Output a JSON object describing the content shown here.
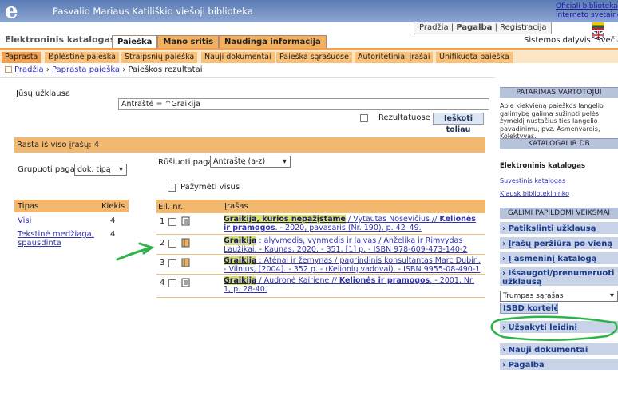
{
  "header": {
    "logo": "e",
    "title": "Pasvalio Mariaus Katiliškio viešoji biblioteka",
    "links": [
      "Oficiali biblioteka",
      "interneto svetainė"
    ]
  },
  "util": {
    "home": "Pradžia",
    "help": "Pagalba",
    "register": "Registracija",
    "member": "Sistemos dalyvis: Svečias"
  },
  "app": {
    "name": "Elektroninis katalogas"
  },
  "tabs": [
    "Paieška",
    "Mano sritis",
    "Naudinga informacija"
  ],
  "subtabs": [
    "Paprasta",
    "Išplėstinė paieška",
    "Straipsnių paieška",
    "Nauji dokumentai",
    "Paieška sąrašuose",
    "Autoritetiniai įrašai",
    "Unifikuota paieška"
  ],
  "breadcrumb": {
    "home": "Pradžia",
    "simple": "Paprasta paieška",
    "current": "Paieškos rezultatai"
  },
  "query": {
    "label": "Jūsų užklausa",
    "value": "Antraštė = ^Graikija",
    "in_results": "Rezultatuose",
    "search_button": "Ieškoti toliau"
  },
  "found": {
    "label": "Rasta iš viso įrašų: 4"
  },
  "group": {
    "label": "Grupuoti pagal",
    "value": "dok. tipą"
  },
  "sort": {
    "label": "Rūšiuoti pagal",
    "value": "Antraštę (a-z)",
    "select_all": "Pažymėti visus"
  },
  "types": {
    "col_type": "Tipas",
    "col_count": "Kiekis",
    "rows": [
      {
        "name": "Visi",
        "count": "4"
      },
      {
        "name": "Tekstinė medžiaga, spausdinta",
        "count": "4"
      }
    ]
  },
  "results": {
    "col_no": "Eil. nr.",
    "col_record": "Įrašas",
    "rows": [
      {
        "no": "1",
        "icon": "article",
        "title": "Graikija, kurios nepažįstame",
        "rest": " / Vytautas Nosevičius // ",
        "src": "Kelionės ir pramogos",
        "tail": ". - 2020, pavasaris (Nr. 190), p. 42–49."
      },
      {
        "no": "2",
        "icon": "book",
        "title": "Graikija",
        "rest": " : alyvmedis, vynmedis ir laivas / Anželika ir Rimvydas Laužikai. - Kaunas, 2020. - 351, [1] p. - ISBN 978-609-473-140-2",
        "src": "",
        "tail": ""
      },
      {
        "no": "3",
        "icon": "book",
        "title": "Graikija",
        "rest": " : Atėnai ir žemynas / pagrindinis konsultantas Marc Dubin. - Vilnius, [2004]. - 352 p. - (Kelionių vadovai). - ISBN 9955-08-490-1",
        "src": "",
        "tail": ""
      },
      {
        "no": "4",
        "icon": "article",
        "title": "Graikija",
        "rest": " / Audronė Kairienė // ",
        "src": "Kelionės ir pramogos",
        "tail": ". - 2001, Nr. 1, p. 28-40."
      }
    ]
  },
  "right": {
    "tip_header": "PATARIMAS VARTOTOJUI",
    "tip_text": "Apie kiekvieną paieškos langelio galimybę galima sužinoti pelės žymeklį nustačius ties langelio pavadinimu, pvz. Asmenvardis, Kolektyvas.",
    "cat_header": "KATALOGAI IR DB",
    "cat_title": "Elektroninis katalogas",
    "cat_links": [
      "Suvestinis katalogas",
      "Klausk bibliotekininko"
    ],
    "act_header": "GALIMI PAPILDOMI VEIKSMAI",
    "actions": [
      "Patikslinti užklausą",
      "Įrašų peržiūra po vieną",
      "Į asmeninį katalogą",
      "Išsaugoti/prenumeruoti užklausą"
    ],
    "list_select": "Trumpas sąrašas",
    "isbd": "ISBD kortelės",
    "order": "Užsakyti leidinį",
    "more": [
      "Nauji dokumentai",
      "Pagalba"
    ]
  },
  "colors": {
    "header": "#5a7bb5",
    "orange": "#f2b870",
    "highlight": "#d9e26a",
    "annotation": "#2db34a"
  }
}
